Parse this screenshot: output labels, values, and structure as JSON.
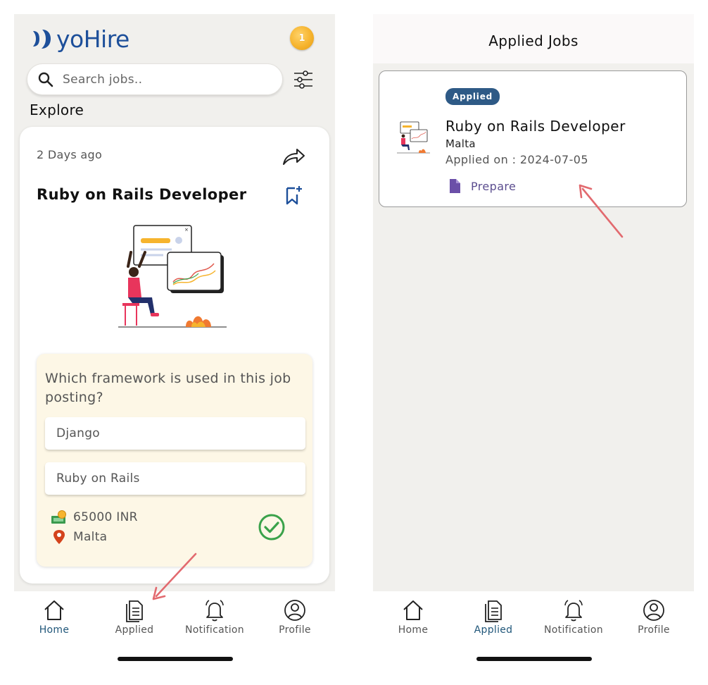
{
  "home": {
    "logo_text": "yoHire",
    "coin_count": "1",
    "search_placeholder": "Search jobs..",
    "section_title": "Explore",
    "job": {
      "posted": "2 Days ago",
      "title": "Ruby on Rails Developer",
      "question": "Which framework is used in this job posting?",
      "options": [
        "Django",
        "Ruby on Rails"
      ],
      "salary": "65000 INR",
      "location": "Malta"
    }
  },
  "applied": {
    "header_title": "Applied Jobs",
    "card": {
      "badge": "Applied",
      "title": "Ruby on Rails Developer",
      "location": "Malta",
      "applied_on": "Applied on : 2024-07-05",
      "action_label": "Prepare"
    }
  },
  "nav": {
    "items": [
      "Home",
      "Applied",
      "Notification",
      "Profile"
    ]
  },
  "colors": {
    "brand_blue": "#1d4f9a",
    "badge_blue": "#2e5a86",
    "active_nav": "#21577a",
    "check_green": "#3aa24a",
    "annotation_arrow": "#e26a6f",
    "quiz_background": "#fdf7e6"
  }
}
